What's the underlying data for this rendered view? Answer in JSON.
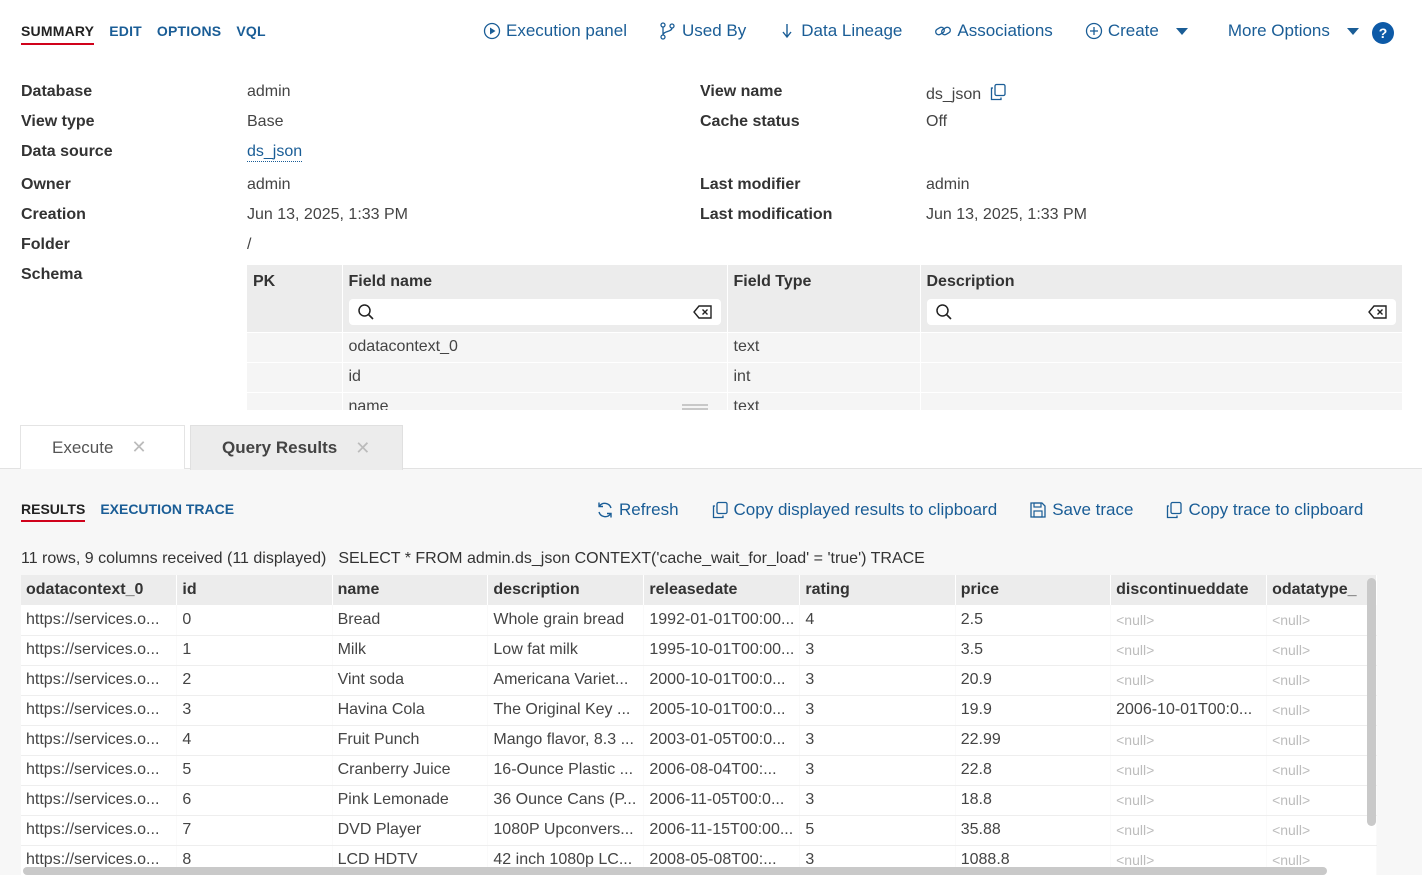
{
  "top_tabs": [
    "SUMMARY",
    "EDIT",
    "OPTIONS",
    "VQL"
  ],
  "actions": {
    "execution_panel": "Execution panel",
    "used_by": "Used By",
    "data_lineage": "Data Lineage",
    "associations": "Associations",
    "create": "Create",
    "more_options": "More Options",
    "help": "?"
  },
  "props": {
    "database_label": "Database",
    "database_value": "admin",
    "view_type_label": "View type",
    "view_type_value": "Base",
    "data_source_label": "Data source",
    "data_source_value": "ds_json",
    "owner_label": "Owner",
    "owner_value": "admin",
    "creation_label": "Creation",
    "creation_value": "Jun 13, 2025, 1:33 PM",
    "folder_label": "Folder",
    "folder_value": "/",
    "schema_label": "Schema",
    "view_name_label": "View name",
    "view_name_value": "ds_json",
    "cache_status_label": "Cache status",
    "cache_status_value": "Off",
    "last_modifier_label": "Last modifier",
    "last_modifier_value": "admin",
    "last_modification_label": "Last modification",
    "last_modification_value": "Jun 13, 2025, 1:33 PM"
  },
  "schema": {
    "headers": [
      "PK",
      "Field name",
      "Field Type",
      "Description"
    ],
    "rows": [
      {
        "pk": "",
        "field": "odatacontext_0",
        "type": "text",
        "desc": ""
      },
      {
        "pk": "",
        "field": "id",
        "type": "int",
        "desc": ""
      },
      {
        "pk": "",
        "field": "name",
        "type": "text",
        "desc": ""
      }
    ]
  },
  "panel_tabs": {
    "execute": "Execute",
    "query_results": "Query Results",
    "close": "✕"
  },
  "result_tabs": [
    "RESULTS",
    "EXECUTION TRACE"
  ],
  "result_actions": {
    "refresh": "Refresh",
    "copy_results": "Copy displayed results to clipboard",
    "save_trace": "Save trace",
    "copy_trace": "Copy trace to clipboard"
  },
  "info": {
    "summary": "11 rows, 9 columns received (11 displayed)",
    "query": "SELECT * FROM admin.ds_json CONTEXT('cache_wait_for_load' = 'true') TRACE"
  },
  "results": {
    "columns": [
      "odatacontext_0",
      "id",
      "name",
      "description",
      "releasedate",
      "rating",
      "price",
      "discontinueddate",
      "odatatype_"
    ],
    "rows": [
      [
        "https://services.o...",
        "0",
        "Bread",
        "Whole grain bread",
        "1992-01-01T00:00...",
        "4",
        "2.5",
        "<null>",
        "<null>"
      ],
      [
        "https://services.o...",
        "1",
        "Milk",
        "Low fat milk",
        "1995-10-01T00:00...",
        "3",
        "3.5",
        "<null>",
        "<null>"
      ],
      [
        "https://services.o...",
        "2",
        "Vint soda",
        "Americana Variet...",
        "2000-10-01T00:0...",
        "3",
        "20.9",
        "<null>",
        "<null>"
      ],
      [
        "https://services.o...",
        "3",
        "Havina Cola",
        "The Original Key ...",
        "2005-10-01T00:0...",
        "3",
        "19.9",
        "2006-10-01T00:0...",
        "<null>"
      ],
      [
        "https://services.o...",
        "4",
        "Fruit Punch",
        "Mango flavor, 8.3 ...",
        "2003-01-05T00:0...",
        "3",
        "22.99",
        "<null>",
        "<null>"
      ],
      [
        "https://services.o...",
        "5",
        "Cranberry Juice",
        "16-Ounce Plastic ...",
        "2006-08-04T00:...",
        "3",
        "22.8",
        "<null>",
        "<null>"
      ],
      [
        "https://services.o...",
        "6",
        "Pink Lemonade",
        "36 Ounce Cans (P...",
        "2006-11-05T00:0...",
        "3",
        "18.8",
        "<null>",
        "<null>"
      ],
      [
        "https://services.o...",
        "7",
        "DVD Player",
        "1080P Upconvers...",
        "2006-11-15T00:00...",
        "5",
        "35.88",
        "<null>",
        "<null>"
      ],
      [
        "https://services.o...",
        "8",
        "LCD HDTV",
        "42 inch 1080p LC...",
        "2008-05-08T00:...",
        "3",
        "1088.8",
        "<null>",
        "<null>"
      ]
    ]
  },
  "colors": {
    "link": "#1a5d96",
    "active_underline": "#d0021b",
    "help_bg": "#0d5aa7",
    "null_text": "#bcbcbc"
  }
}
